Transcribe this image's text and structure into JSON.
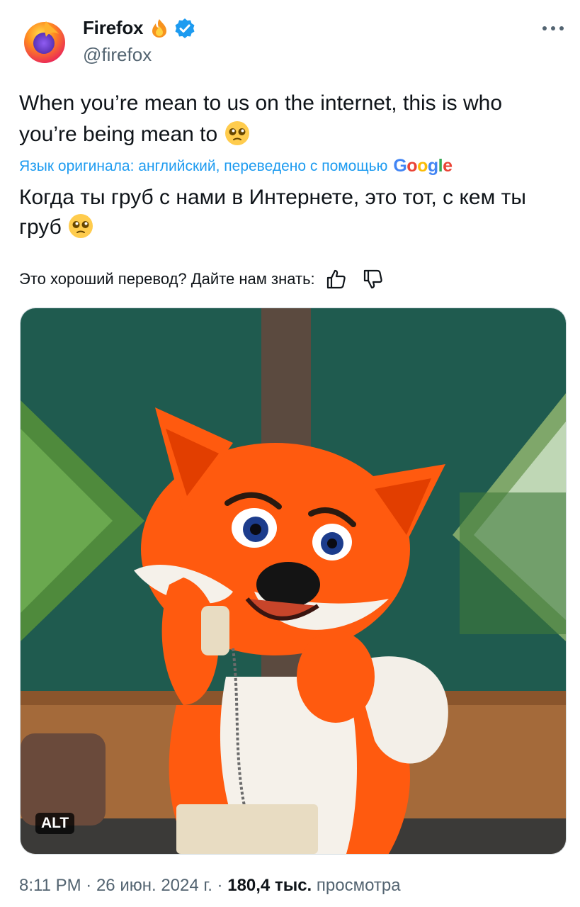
{
  "author": {
    "name": "Firefox",
    "handle": "@firefox",
    "avatar_icon": "firefox-logo-icon",
    "badge_emoji_icon": "fire-icon",
    "verified_icon": "verified-badge-icon"
  },
  "menu": {
    "icon": "more-options-icon"
  },
  "tweet": {
    "text": "When you’re mean to us on the internet, this is who you’re being mean to",
    "emoji_icon": "pleading-face-icon"
  },
  "translation": {
    "note": "Язык оригинала: английский, переведено с помощью",
    "provider": "Google",
    "text": "Когда ты груб с нами в Интернете, это тот, с кем ты груб"
  },
  "feedback": {
    "prompt": "Это хороший перевод? Дайте нам знать:",
    "like_icon": "thumbs-up-icon",
    "dislike_icon": "thumbs-down-icon"
  },
  "media": {
    "alt_badge": "ALT"
  },
  "meta": {
    "time": "8:11 PM",
    "date": "26 июн. 2024 г.",
    "separator": "·",
    "views_count": "180,4 тыс.",
    "views_label": "просмотра"
  },
  "colors": {
    "link_blue": "#1d9bf0",
    "secondary_text": "#536471",
    "primary_text": "#0f1419"
  }
}
